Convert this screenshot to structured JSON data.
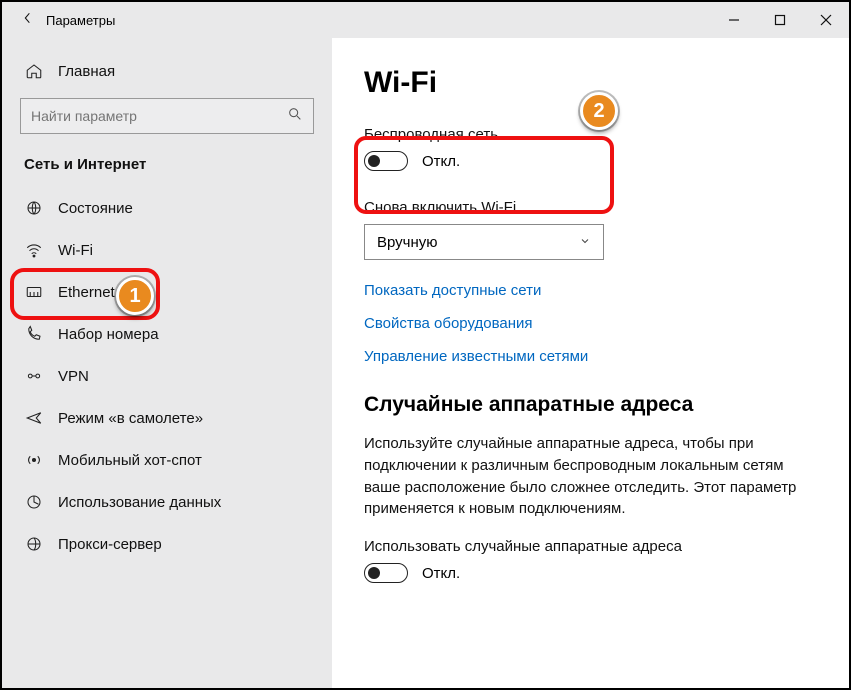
{
  "titlebar": {
    "title": "Параметры"
  },
  "sidebar": {
    "home": "Главная",
    "search_placeholder": "Найти параметр",
    "group": "Сеть и Интернет",
    "items": [
      {
        "label": "Состояние"
      },
      {
        "label": "Wi-Fi"
      },
      {
        "label": "Ethernet"
      },
      {
        "label": "Набор номера"
      },
      {
        "label": "VPN"
      },
      {
        "label": "Режим «в самолете»"
      },
      {
        "label": "Мобильный хот-спот"
      },
      {
        "label": "Использование данных"
      },
      {
        "label": "Прокси-сервер"
      }
    ]
  },
  "main": {
    "heading": "Wi-Fi",
    "wireless_label": "Беспроводная сеть",
    "wireless_state": "Откл.",
    "reenable_label": "Снова включить Wi-Fi",
    "reenable_value": "Вручную",
    "link_networks": "Показать доступные сети",
    "link_hardware": "Свойства оборудования",
    "link_known": "Управление известными сетями",
    "random_heading": "Случайные аппаратные адреса",
    "random_text": "Используйте случайные аппаратные адреса, чтобы при подключении к различным беспроводным локальным сетям ваше расположение было сложнее отследить. Этот параметр применяется к новым подключениям.",
    "random_toggle_label": "Использовать случайные аппаратные адреса",
    "random_toggle_state": "Откл."
  },
  "badges": {
    "b1": "1",
    "b2": "2"
  }
}
